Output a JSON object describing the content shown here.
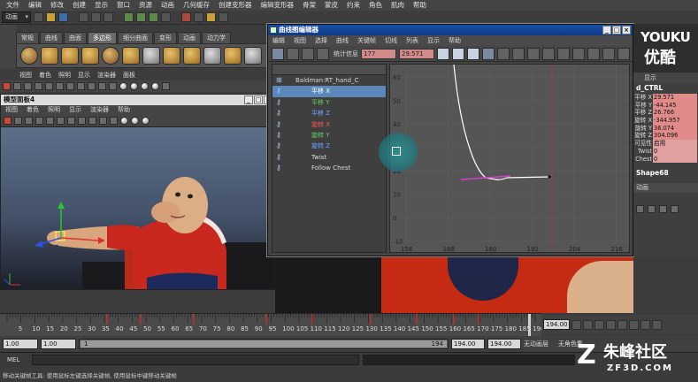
{
  "menubar": [
    "文件",
    "编辑",
    "修改",
    "创建",
    "显示",
    "窗口",
    "资源",
    "动画",
    "几何缓存",
    "创建变形器",
    "编辑变形器",
    "骨架",
    "蒙皮",
    "约束",
    "角色",
    "肌肉",
    "帮助"
  ],
  "status": {
    "mode": "动画"
  },
  "shelf_tabs": [
    {
      "label": "常规",
      "active": false
    },
    {
      "label": "曲线",
      "active": false
    },
    {
      "label": "曲面",
      "active": false
    },
    {
      "label": "多边形",
      "active": true
    },
    {
      "label": "细分曲面",
      "active": false
    },
    {
      "label": "变形",
      "active": false
    },
    {
      "label": "动画",
      "active": false
    },
    {
      "label": "动力学",
      "active": false
    }
  ],
  "viewport_menu": [
    "视图",
    "着色",
    "照明",
    "显示",
    "渲染器",
    "面板"
  ],
  "model_panel": {
    "title": "模型面板4",
    "menu": [
      "视图",
      "着色",
      "照明",
      "显示",
      "渲染器",
      "帮助"
    ]
  },
  "graph_editor": {
    "title": "曲线图编辑器",
    "menu": [
      "编辑",
      "视图",
      "选择",
      "曲线",
      "关键帧",
      "切线",
      "列表",
      "显示",
      "帮助"
    ],
    "stats_label": "统计信息",
    "frame_value": "177",
    "value_value": "29.571",
    "outliner_root": "Baldman:RT_hand_C",
    "outliner_items": [
      {
        "label": "平移 X",
        "color": "#ffffff",
        "selected": true
      },
      {
        "label": "平移 Y",
        "color": "#5fd35f",
        "selected": false
      },
      {
        "label": "平移 Z",
        "color": "#6aa8ff",
        "selected": false
      },
      {
        "label": "旋转 X",
        "color": "#ff5555",
        "selected": false
      },
      {
        "label": "旋转 Y",
        "color": "#5fd35f",
        "selected": false
      },
      {
        "label": "旋转 Z",
        "color": "#6aa8ff",
        "selected": false
      },
      {
        "label": "Twist",
        "color": "#d8d8d8",
        "selected": false
      },
      {
        "label": "Follow Chest",
        "color": "#d8d8d8",
        "selected": false
      }
    ],
    "y_ticks": [
      "60",
      "50",
      "40",
      "30",
      "20",
      "10",
      "0",
      "-10"
    ],
    "x_ticks": [
      "156",
      "168",
      "180",
      "192",
      "204",
      "216"
    ]
  },
  "logo": {
    "line1": "YOUKU",
    "line2": "优酷"
  },
  "channel_box": {
    "tab": "显示",
    "node": "d_CTRL",
    "channels": [
      {
        "name": "平移 X",
        "value": "29.571"
      },
      {
        "name": "平移 Y",
        "value": "-44.145"
      },
      {
        "name": "平移 Z",
        "value": "26.766"
      },
      {
        "name": "旋转 X",
        "value": "-344.957"
      },
      {
        "name": "旋转 Y",
        "value": "36.074"
      },
      {
        "name": "旋转 Z",
        "value": "304.096"
      },
      {
        "name": "可见性",
        "value": "启用"
      },
      {
        "name": "Twist",
        "value": "0"
      },
      {
        "name": "Chest",
        "value": "0"
      }
    ],
    "shape": "Shape68",
    "anim_tab": "动画"
  },
  "timeline": {
    "ticks": [
      "5",
      "10",
      "15",
      "20",
      "25",
      "30",
      "35",
      "40",
      "45",
      "50",
      "55",
      "60",
      "65",
      "70",
      "75",
      "80",
      "85",
      "90",
      "95",
      "100",
      "105",
      "110",
      "115",
      "120",
      "125",
      "130",
      "135",
      "140",
      "145",
      "150",
      "155",
      "160",
      "165",
      "170",
      "175",
      "180",
      "185",
      "190"
    ],
    "current_frame": "194.00"
  },
  "range": {
    "start": "1.00",
    "inner_start": "1.00",
    "slider_start": "1",
    "slider_end": "194",
    "end": "194.00",
    "outer_end": "194.00",
    "char_set": "无动画层",
    "char_set2": "无角色集"
  },
  "mel_label": "MEL",
  "help_text": "移动关键帧工具: 使用鼠标左键选择关键帧, 使用鼠标中键移动关键帧",
  "watermark": {
    "line1": "朱峰社区",
    "line2": "ZF3D.COM"
  }
}
